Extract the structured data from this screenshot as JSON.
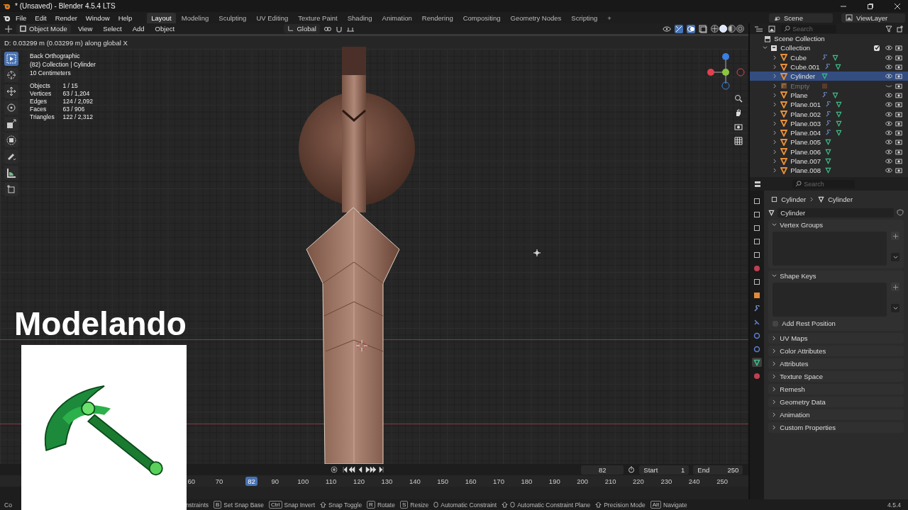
{
  "window": {
    "title": "* (Unsaved) - Blender 4.5.4 LTS"
  },
  "menu": [
    "File",
    "Edit",
    "Render",
    "Window",
    "Help"
  ],
  "workspaces": [
    {
      "label": "Layout",
      "selected": true
    },
    {
      "label": "Modeling",
      "selected": false
    },
    {
      "label": "Sculpting",
      "selected": false
    },
    {
      "label": "UV Editing",
      "selected": false
    },
    {
      "label": "Texture Paint",
      "selected": false
    },
    {
      "label": "Shading",
      "selected": false
    },
    {
      "label": "Animation",
      "selected": false
    },
    {
      "label": "Rendering",
      "selected": false
    },
    {
      "label": "Compositing",
      "selected": false
    },
    {
      "label": "Geometry Nodes",
      "selected": false
    },
    {
      "label": "Scripting",
      "selected": false
    }
  ],
  "add_workspace": "+",
  "scene": "Scene",
  "view_layer": "ViewLayer",
  "viewport_header": {
    "mode": "Object Mode",
    "menus": [
      "View",
      "Select",
      "Add",
      "Object"
    ],
    "orientation": "Global"
  },
  "shading_modes": [
    {
      "kind": "wireframe",
      "selected": false
    },
    {
      "kind": "solid",
      "selected": true
    },
    {
      "kind": "material",
      "selected": false
    },
    {
      "kind": "rendered",
      "selected": false
    }
  ],
  "operator_status": "D: 0.03299 m (0.03299 m) along global X",
  "viewport_info": {
    "lines": [
      "Back Orthographic",
      "(82) Collection | Cylinder",
      "10 Centimeters"
    ],
    "stats": [
      {
        "label": "Objects",
        "value": "1 / 15"
      },
      {
        "label": "Vertices",
        "value": "63 / 1,204"
      },
      {
        "label": "Edges",
        "value": "124 / 2,092"
      },
      {
        "label": "Faces",
        "value": "63 / 906"
      },
      {
        "label": "Triangles",
        "value": "122 / 2,312"
      }
    ]
  },
  "tools": [
    {
      "kind": "select",
      "selected": true
    },
    {
      "kind": "cursor",
      "selected": false
    },
    {
      "kind": "move",
      "selected": false
    },
    {
      "kind": "rotate",
      "selected": false
    },
    {
      "kind": "scale",
      "selected": false
    },
    {
      "kind": "transform",
      "selected": false
    },
    {
      "kind": "annotate",
      "selected": false
    },
    {
      "kind": "measure",
      "selected": false
    },
    {
      "kind": "add-cube",
      "selected": false
    }
  ],
  "overlay": {
    "title": "Modelando"
  },
  "outliner": {
    "search_placeholder": "Search",
    "root": "Scene Collection",
    "collection": {
      "name": "Collection",
      "checked": true,
      "children": [
        {
          "name": "Cube",
          "kind": "mesh",
          "modifier": true,
          "selected": false,
          "visible": true
        },
        {
          "name": "Cube.001",
          "kind": "mesh",
          "modifier": true,
          "selected": false,
          "visible": true
        },
        {
          "name": "Cylinder",
          "kind": "mesh",
          "modifier": false,
          "selected": true,
          "visible": true
        },
        {
          "name": "Empty",
          "kind": "empty",
          "modifier": false,
          "selected": false,
          "visible": false
        },
        {
          "name": "Plane",
          "kind": "mesh",
          "modifier": true,
          "selected": false,
          "visible": true
        },
        {
          "name": "Plane.001",
          "kind": "mesh",
          "modifier": true,
          "selected": false,
          "visible": true
        },
        {
          "name": "Plane.002",
          "kind": "mesh",
          "modifier": true,
          "selected": false,
          "visible": true
        },
        {
          "name": "Plane.003",
          "kind": "mesh",
          "modifier": true,
          "selected": false,
          "visible": true
        },
        {
          "name": "Plane.004",
          "kind": "mesh",
          "modifier": true,
          "selected": false,
          "visible": true
        },
        {
          "name": "Plane.005",
          "kind": "mesh",
          "modifier": false,
          "selected": false,
          "visible": true
        },
        {
          "name": "Plane.006",
          "kind": "mesh",
          "modifier": false,
          "selected": false,
          "visible": true
        },
        {
          "name": "Plane.007",
          "kind": "mesh",
          "modifier": false,
          "selected": false,
          "visible": true
        },
        {
          "name": "Plane.008",
          "kind": "mesh",
          "modifier": false,
          "selected": false,
          "visible": true
        }
      ]
    }
  },
  "properties": {
    "search_placeholder": "Search",
    "breadcrumb": [
      "Cylinder",
      "Cylinder"
    ],
    "mesh_name": "Cylinder",
    "tabs": [
      {
        "kind": "tool",
        "selected": false
      },
      {
        "kind": "render",
        "selected": false
      },
      {
        "kind": "output",
        "selected": false
      },
      {
        "kind": "view-layer",
        "selected": false
      },
      {
        "kind": "scene",
        "selected": false
      },
      {
        "kind": "world",
        "selected": false
      },
      {
        "kind": "collection",
        "selected": false
      },
      {
        "kind": "object",
        "selected": false
      },
      {
        "kind": "modifier",
        "selected": false
      },
      {
        "kind": "particles",
        "selected": false
      },
      {
        "kind": "physics",
        "selected": false
      },
      {
        "kind": "constraint",
        "selected": false
      },
      {
        "kind": "data",
        "selected": true
      },
      {
        "kind": "material",
        "selected": false
      }
    ],
    "panels": [
      {
        "title": "Vertex Groups",
        "expanded": true
      },
      {
        "title": "Shape Keys",
        "expanded": true,
        "option": {
          "label": "Add Rest Position",
          "checked": false
        }
      },
      {
        "title": "UV Maps",
        "expanded": false
      },
      {
        "title": "Color Attributes",
        "expanded": false
      },
      {
        "title": "Attributes",
        "expanded": false
      },
      {
        "title": "Texture Space",
        "expanded": false
      },
      {
        "title": "Remesh",
        "expanded": false
      },
      {
        "title": "Geometry Data",
        "expanded": false
      },
      {
        "title": "Animation",
        "expanded": false
      },
      {
        "title": "Custom Properties",
        "expanded": false
      }
    ]
  },
  "timeline": {
    "current_frame": "82",
    "start_label": "Start",
    "start": "1",
    "end_label": "End",
    "end": "250",
    "ruler": [
      {
        "kind": "tick",
        "label": "60"
      },
      {
        "kind": "tick",
        "label": "70"
      },
      {
        "kind": "playhead",
        "label": "82"
      },
      {
        "kind": "tick",
        "label": "90"
      },
      {
        "kind": "tick",
        "label": "100"
      },
      {
        "kind": "tick",
        "label": "110"
      },
      {
        "kind": "tick",
        "label": "120"
      },
      {
        "kind": "tick",
        "label": "130"
      },
      {
        "kind": "tick",
        "label": "140"
      },
      {
        "kind": "tick",
        "label": "150"
      },
      {
        "kind": "tick",
        "label": "160"
      },
      {
        "kind": "tick",
        "label": "170"
      },
      {
        "kind": "tick",
        "label": "180"
      },
      {
        "kind": "tick",
        "label": "190"
      },
      {
        "kind": "tick",
        "label": "200"
      },
      {
        "kind": "tick",
        "label": "210"
      },
      {
        "kind": "tick",
        "label": "220"
      },
      {
        "kind": "tick",
        "label": "230"
      },
      {
        "kind": "tick",
        "label": "240"
      },
      {
        "kind": "tick",
        "label": "250"
      }
    ]
  },
  "status_left": "Co",
  "status_bar": [
    {
      "kind": "text",
      "label": "nstraints"
    },
    {
      "kind": "key",
      "key": "B",
      "label": "Set Snap Base"
    },
    {
      "kind": "key",
      "key": "Ctrl",
      "label": "Snap Invert"
    },
    {
      "kind": "shift",
      "label": "Snap Toggle"
    },
    {
      "kind": "key",
      "key": "R",
      "label": "Rotate"
    },
    {
      "kind": "key",
      "key": "S",
      "label": "Resize"
    },
    {
      "kind": "mouse",
      "label": "Automatic Constraint"
    },
    {
      "kind": "shift-mouse",
      "label": "Automatic Constraint Plane"
    },
    {
      "kind": "shift",
      "label": "Precision Mode"
    },
    {
      "kind": "key",
      "key": "Alt",
      "label": "Navigate"
    }
  ],
  "version": "4.5.4"
}
